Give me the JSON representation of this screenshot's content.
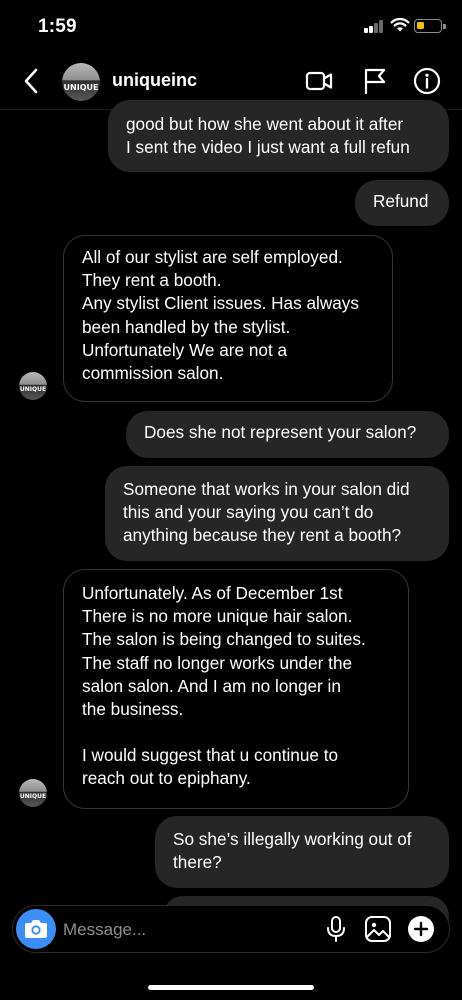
{
  "status_bar": {
    "time": "1:59",
    "battery_color": "#f5c400"
  },
  "header": {
    "username": "uniqueinc",
    "avatar_text": "UNIQUE"
  },
  "messages": [
    {
      "from": "me",
      "lines": [
        "good but how she went about it after",
        "I sent the video I just want a full refun"
      ]
    },
    {
      "from": "me",
      "lines": [
        "Refund"
      ]
    },
    {
      "from": "them",
      "lines": [
        "All of our stylist are self employed.",
        "They rent a booth.",
        "Any stylist Client issues. Has always",
        "been handled by the stylist.",
        "Unfortunately We are not a",
        "commission salon."
      ]
    },
    {
      "from": "me",
      "lines": [
        "Does she not represent your salon?"
      ]
    },
    {
      "from": "me",
      "lines": [
        "Someone that works in your salon did",
        "this and your saying you can’t do",
        "anything because they rent a booth?"
      ]
    },
    {
      "from": "them",
      "lines": [
        "Unfortunately. As of December 1st",
        "There is no more unique hair salon.",
        "The salon is being changed to suites.",
        "The staff no longer works under the",
        "salon salon.  And I am  no longer in",
        "the business.",
        "",
        "I would suggest that u continue to",
        "reach out to epiphany."
      ]
    },
    {
      "from": "me",
      "lines": [
        "So she’s illegally working out of",
        "there?"
      ]
    }
  ],
  "composer": {
    "placeholder": "Message...",
    "accent": "#3a8ef5"
  },
  "icons": [
    "back-icon",
    "video-call-icon",
    "flag-icon",
    "info-icon",
    "camera-icon",
    "microphone-icon",
    "gallery-icon",
    "plus-icon"
  ]
}
